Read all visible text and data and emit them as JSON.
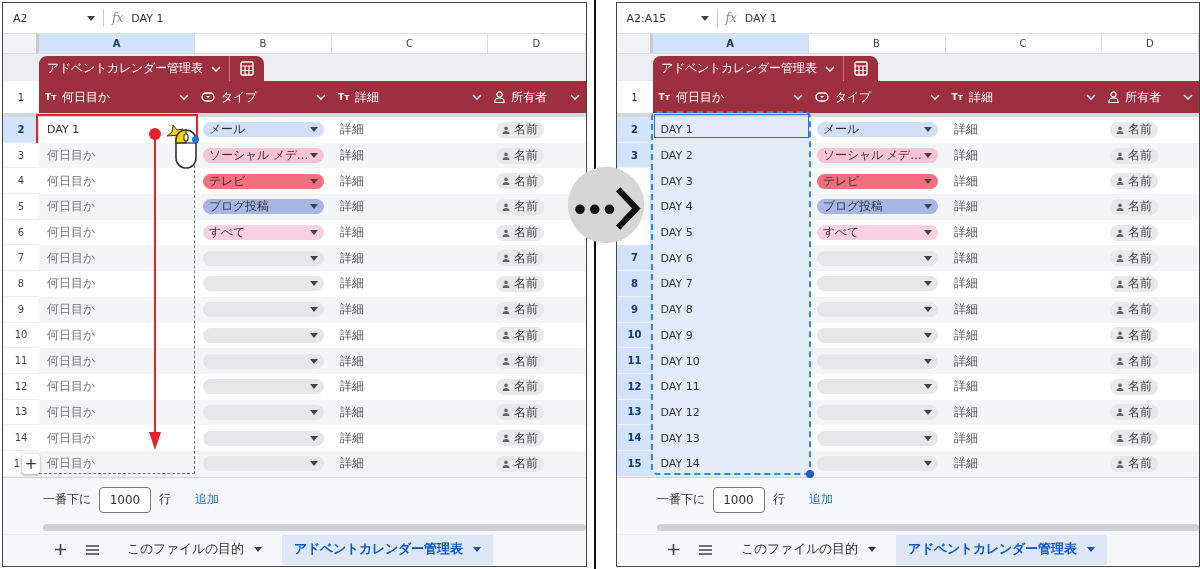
{
  "panels": [
    {
      "name_box": "A2",
      "fx": "fx",
      "formula": "DAY 1",
      "column_letters": [
        {
          "label": "A",
          "selected": true
        },
        {
          "label": "B",
          "selected": false
        },
        {
          "label": "C",
          "selected": false
        },
        {
          "label": "D",
          "selected": false
        }
      ],
      "table_name": "アドベントカレンダー管理表",
      "header_number": "1",
      "header_columns": [
        {
          "kind": "text",
          "glyph": "Tт",
          "label": "何日目か"
        },
        {
          "kind": "dropdown",
          "label": "タイプ"
        },
        {
          "kind": "text",
          "glyph": "Tт",
          "label": "詳細"
        },
        {
          "kind": "person",
          "label": "所有者"
        }
      ],
      "rows": [
        {
          "number": "2",
          "selected": true,
          "a": {
            "value": "DAY 1"
          },
          "type": {
            "label": "メール",
            "color": "#cfe0f8"
          },
          "detail": "詳細",
          "owner": "名前"
        },
        {
          "number": "3",
          "selected": false,
          "a": {
            "placeholder": "何日目か"
          },
          "type": {
            "label": "ソーシャル メデ…",
            "color": "#f9c3d6"
          },
          "detail": "詳細",
          "owner": "名前"
        },
        {
          "number": "4",
          "selected": false,
          "a": {
            "placeholder": "何日目か"
          },
          "type": {
            "label": "テレビ",
            "color": "#f2707e"
          },
          "detail": "詳細",
          "owner": "名前"
        },
        {
          "number": "5",
          "selected": false,
          "a": {
            "placeholder": "何日目か"
          },
          "type": {
            "label": "ブログ投稿",
            "color": "#a8b6e6"
          },
          "detail": "詳細",
          "owner": "名前"
        },
        {
          "number": "6",
          "selected": false,
          "a": {
            "placeholder": "何日目か"
          },
          "type": {
            "label": "すべて",
            "color": "#fbd0e0"
          },
          "detail": "詳細",
          "owner": "名前"
        },
        {
          "number": "7",
          "selected": false,
          "a": {
            "placeholder": "何日目か"
          },
          "type": {
            "color": "#e6e7e9"
          },
          "detail": "詳細",
          "owner": "名前"
        },
        {
          "number": "8",
          "selected": false,
          "a": {
            "placeholder": "何日目か"
          },
          "type": {
            "color": "#e6e7e9"
          },
          "detail": "詳細",
          "owner": "名前"
        },
        {
          "number": "9",
          "selected": false,
          "a": {
            "placeholder": "何日目か"
          },
          "type": {
            "color": "#e6e7e9"
          },
          "detail": "詳細",
          "owner": "名前"
        },
        {
          "number": "10",
          "selected": false,
          "a": {
            "placeholder": "何日目か"
          },
          "type": {
            "color": "#e6e7e9"
          },
          "detail": "詳細",
          "owner": "名前"
        },
        {
          "number": "11",
          "selected": false,
          "a": {
            "placeholder": "何日目か"
          },
          "type": {
            "color": "#e6e7e9"
          },
          "detail": "詳細",
          "owner": "名前"
        },
        {
          "number": "12",
          "selected": false,
          "a": {
            "placeholder": "何日目か"
          },
          "type": {
            "color": "#e6e7e9"
          },
          "detail": "詳細",
          "owner": "名前"
        },
        {
          "number": "13",
          "selected": false,
          "a": {
            "placeholder": "何日目か"
          },
          "type": {
            "color": "#e6e7e9"
          },
          "detail": "詳細",
          "owner": "名前"
        },
        {
          "number": "14",
          "selected": false,
          "a": {
            "placeholder": "何日目か"
          },
          "type": {
            "color": "#e6e7e9"
          },
          "detail": "詳細",
          "owner": "名前"
        },
        {
          "number": "1",
          "plus": "+",
          "selected": false,
          "a": {
            "placeholder": "何日目か"
          },
          "type": {
            "color": "#e6e7e9"
          },
          "detail": "詳細",
          "owner": "名前"
        }
      ],
      "footer": {
        "prefix": "一番下に",
        "count": "1000",
        "unit": "行",
        "add": "追加"
      },
      "sheet_tabs": [
        {
          "label": "このファイルの目的",
          "selected": false
        },
        {
          "label": "アドベントカレンダー管理表",
          "selected": true
        }
      ],
      "overlay": {
        "kind": "drag"
      }
    },
    {
      "name_box": "A2:A15",
      "fx": "fx",
      "formula": "DAY 1",
      "column_letters": [
        {
          "label": "A",
          "selected": true
        },
        {
          "label": "B",
          "selected": false
        },
        {
          "label": "C",
          "selected": false
        },
        {
          "label": "D",
          "selected": false
        }
      ],
      "table_name": "アドベントカレンダー管理表",
      "header_number": "1",
      "header_columns": [
        {
          "kind": "text",
          "glyph": "Tт",
          "label": "何日目か"
        },
        {
          "kind": "dropdown",
          "label": "タイプ"
        },
        {
          "kind": "text",
          "glyph": "Tт",
          "label": "詳細"
        },
        {
          "kind": "person",
          "label": "所有者"
        }
      ],
      "rows": [
        {
          "number": "2",
          "selected": true,
          "a": {
            "value": "DAY 1"
          },
          "type": {
            "label": "メール",
            "color": "#cfe0f8"
          },
          "detail": "詳細",
          "owner": "名前"
        },
        {
          "number": "3",
          "selected": true,
          "a": {
            "value": "DAY 2"
          },
          "type": {
            "label": "ソーシャル メデ…",
            "color": "#f9c3d6"
          },
          "detail": "詳細",
          "owner": "名前"
        },
        {
          "selected": true,
          "a": {
            "value": "DAY 3"
          },
          "type": {
            "label": "テレビ",
            "color": "#f2707e"
          },
          "detail": "詳細",
          "owner": "名前"
        },
        {
          "selected": true,
          "a": {
            "value": "DAY 4"
          },
          "type": {
            "label": "ブログ投稿",
            "color": "#a8b6e6"
          },
          "detail": "詳細",
          "owner": "名前"
        },
        {
          "selected": true,
          "a": {
            "value": "DAY 5"
          },
          "type": {
            "label": "すべて",
            "color": "#fbd0e0"
          },
          "detail": "詳細",
          "owner": "名前"
        },
        {
          "number": "7",
          "selected": true,
          "a": {
            "value": "DAY 6"
          },
          "type": {
            "color": "#e6e7e9"
          },
          "detail": "詳細",
          "owner": "名前"
        },
        {
          "number": "8",
          "selected": true,
          "a": {
            "value": "DAY 7"
          },
          "type": {
            "color": "#e6e7e9"
          },
          "detail": "詳細",
          "owner": "名前"
        },
        {
          "number": "9",
          "selected": true,
          "a": {
            "value": "DAY 8"
          },
          "type": {
            "color": "#e6e7e9"
          },
          "detail": "詳細",
          "owner": "名前"
        },
        {
          "number": "10",
          "selected": true,
          "a": {
            "value": "DAY 9"
          },
          "type": {
            "color": "#e6e7e9"
          },
          "detail": "詳細",
          "owner": "名前"
        },
        {
          "number": "11",
          "selected": true,
          "a": {
            "value": "DAY 10"
          },
          "type": {
            "color": "#e6e7e9"
          },
          "detail": "詳細",
          "owner": "名前"
        },
        {
          "number": "12",
          "selected": true,
          "a": {
            "value": "DAY 11"
          },
          "type": {
            "color": "#e6e7e9"
          },
          "detail": "詳細",
          "owner": "名前"
        },
        {
          "number": "13",
          "selected": true,
          "a": {
            "value": "DAY 12"
          },
          "type": {
            "color": "#e6e7e9"
          },
          "detail": "詳細",
          "owner": "名前"
        },
        {
          "number": "14",
          "selected": true,
          "a": {
            "value": "DAY 13"
          },
          "type": {
            "color": "#e6e7e9"
          },
          "detail": "詳細",
          "owner": "名前"
        },
        {
          "number": "15",
          "selected": true,
          "a": {
            "value": "DAY 14"
          },
          "type": {
            "color": "#e6e7e9"
          },
          "detail": "詳細",
          "owner": "名前"
        }
      ],
      "footer": {
        "prefix": "一番下に",
        "count": "1000",
        "unit": "行",
        "add": "追加"
      },
      "sheet_tabs": [
        {
          "label": "このファイルの目的",
          "selected": false
        },
        {
          "label": "アドベントカレンダー管理表",
          "selected": true
        }
      ],
      "overlay": {
        "kind": "range"
      }
    }
  ]
}
